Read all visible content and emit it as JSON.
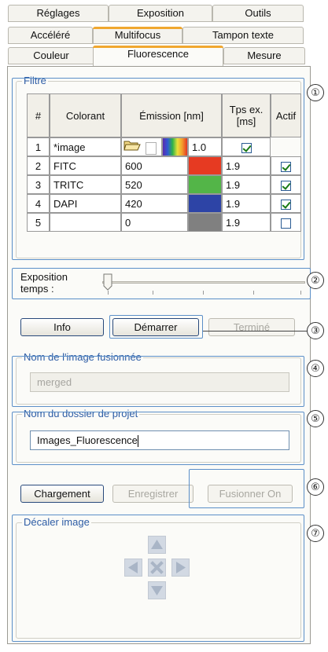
{
  "tabs": {
    "row1": [
      "Réglages",
      "Exposition",
      "Outils"
    ],
    "row2": [
      "Accéléré",
      "Multifocus",
      "Tampon texte"
    ],
    "row3": [
      "Couleur",
      "Fluorescence",
      "Mesure"
    ]
  },
  "filter": {
    "legend": "Filtre",
    "headers": {
      "num": "#",
      "dye": "Colorant",
      "emission": "Émission [nm]",
      "exposure": "Tps ex. [ms]",
      "active": "Actif"
    },
    "rows": [
      {
        "num": "1",
        "dye": "*image",
        "emission": "",
        "exposure": "1.0",
        "active": true,
        "swatch": "spectrum"
      },
      {
        "num": "2",
        "dye": "FITC",
        "emission": "600",
        "exposure": "1.9",
        "active": true,
        "swatch": "#e63a22"
      },
      {
        "num": "3",
        "dye": "TRITC",
        "emission": "520",
        "exposure": "1.9",
        "active": true,
        "swatch": "#53b548"
      },
      {
        "num": "4",
        "dye": "DAPI",
        "emission": "420",
        "exposure": "1.9",
        "active": true,
        "swatch": "#2d44a6"
      },
      {
        "num": "5",
        "dye": "",
        "emission": "0",
        "exposure": "1.9",
        "active": false,
        "swatch": "#808080"
      }
    ]
  },
  "exposure": {
    "label": "Exposition temps :",
    "slider_fraction": 0.0
  },
  "buttons": {
    "info": "Info",
    "start": "Démarrer",
    "done": "Terminé",
    "load": "Chargement",
    "save": "Enregistrer",
    "merge_on": "Fusionner On"
  },
  "merged_name": {
    "legend": "Nom de l'image fusionnée",
    "value": "merged"
  },
  "project_folder": {
    "legend": "Nom du dossier de projet",
    "value": "Images_Fluorescence"
  },
  "shift_image": {
    "legend": "Décaler image"
  },
  "callouts": [
    "①",
    "②",
    "③",
    "④",
    "⑤",
    "⑥",
    "⑦"
  ],
  "colors": {
    "accent_tab": "#f0a72f",
    "callout_box": "#5b8fc8",
    "legend_text": "#2d5ca5",
    "arrow_icon": "#a9b5c6"
  }
}
